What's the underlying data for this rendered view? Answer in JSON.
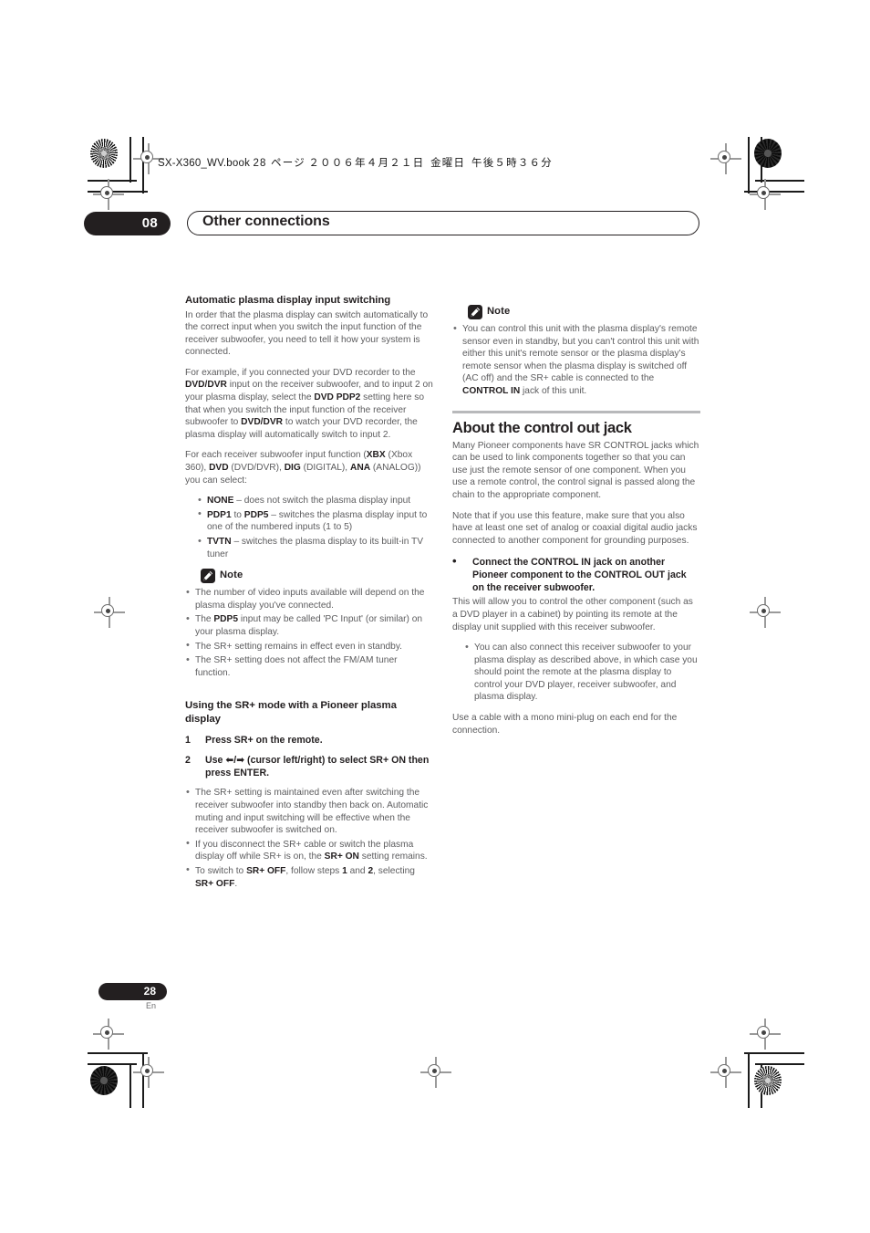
{
  "printer_slug": {
    "filename": "SX-X360_WV.book",
    "page_ref": "28 ページ",
    "date": "２００６年４月２１日",
    "weekday": "金曜日",
    "time": "午後５時３６分"
  },
  "running_head": {
    "chapter_number": "08",
    "title": "Other connections"
  },
  "left_column": {
    "heading": "Automatic plasma display input switching",
    "para1": "In order that the plasma display can switch automatically to the correct input when you switch the input function of the receiver subwoofer, you need to tell it how your system is connected.",
    "para2_a": "For example, if you connected your DVD recorder to the ",
    "para2_b1": "DVD/DVR",
    "para2_c": " input on the receiver subwoofer, and to input 2 on your plasma display, select the ",
    "para2_b2": "DVD PDP2",
    "para2_d": " setting here so that when you switch the input function of the receiver subwoofer to ",
    "para2_b3": "DVD/DVR",
    "para2_e": " to watch your DVD recorder, the plasma display will automatically switch to input 2.",
    "para3_a": "For each receiver subwoofer input function (",
    "para3_b1": "XBX",
    "para3_c": " (Xbox 360), ",
    "para3_b2": "DVD",
    "para3_d": " (DVD/DVR), ",
    "para3_b3": "DIG",
    "para3_e": " (DIGITAL), ",
    "para3_b4": "ANA",
    "para3_f": " (ANALOG)) you can select:",
    "options": [
      {
        "term": "NONE",
        "rest": " – does not switch the plasma display input"
      },
      {
        "term": "PDP1",
        "mid": " to ",
        "term2": "PDP5",
        "rest": " – switches the plasma display input to one of the numbered inputs (1 to 5)"
      },
      {
        "term": "TVTN",
        "rest": " – switches the plasma display to its built-in TV tuner"
      }
    ],
    "note_label": "Note",
    "note_items": [
      {
        "a": "The number of video inputs available will depend on the plasma display you've connected."
      },
      {
        "a": "The ",
        "b": "PDP5",
        "c": " input may be called 'PC Input' (or similar) on your plasma display."
      },
      {
        "a": "The SR+ setting remains in effect even in standby."
      },
      {
        "a": "The SR+ setting does not affect the FM/AM tuner function."
      }
    ],
    "sr_heading": "Using the SR+ mode with a Pioneer plasma display",
    "steps": [
      {
        "num": "1",
        "text": "Press SR+ on the remote."
      },
      {
        "num": "2",
        "text_a": "Use ",
        "arrows": "⬅/➡",
        "text_b": " (cursor left/right) to select SR+ ON then press ENTER."
      }
    ],
    "step2_bullets": [
      {
        "a": "The SR+ setting is maintained even after switching the receiver subwoofer into standby then back on. Automatic muting and input switching will be effective when the receiver subwoofer is switched on."
      },
      {
        "a": "If you disconnect the SR+ cable or switch the plasma display off while SR+ is on, the ",
        "b": "SR+ ON",
        "c": " setting remains."
      },
      {
        "a": "To switch to ",
        "b": "SR+ OFF",
        "c": ", follow steps ",
        "d": "1",
        "e": " and ",
        "f": "2",
        "g": ", selecting ",
        "h": "SR+ OFF",
        "i": "."
      }
    ]
  },
  "right_column": {
    "note_label": "Note",
    "note_items": [
      {
        "a": "You can control this unit with the plasma display's remote sensor even in standby, but you can't control this unit with either this unit's remote sensor or the plasma display's remote sensor when the plasma display is switched off (AC off) and the SR+ cable is connected to the ",
        "b": "CONTROL IN",
        "c": " jack of this unit."
      }
    ],
    "section_heading": "About the control out jack",
    "para1": "Many Pioneer components have SR CONTROL jacks which can be used to link components together so that you can use just the remote sensor of one component. When you use a remote control, the control signal is passed along the chain to the appropriate component.",
    "para2": "Note that if you use this feature, make sure that you also have at least one set of analog or coaxial digital audio jacks connected to another component for grounding purposes.",
    "strong_bullet": "Connect the CONTROL IN jack on another Pioneer component to the CONTROL OUT jack on the receiver subwoofer.",
    "para3": "This will allow you to control the other component (such as a DVD player in a cabinet) by pointing its remote at the display unit supplied with this receiver subwoofer.",
    "bullets": [
      {
        "a": "You can also connect this receiver subwoofer to your plasma display as described above, in which case you should point the remote at the plasma display to control your DVD player, receiver subwoofer, and plasma display."
      }
    ],
    "para4": "Use a cable with a mono mini-plug on each end for the connection."
  },
  "footer": {
    "page_number": "28",
    "language": "En"
  },
  "colors": {
    "ink_black": "#231f20",
    "body_gray": "#5c5c5e",
    "rule_gray": "#b8b9bb"
  }
}
